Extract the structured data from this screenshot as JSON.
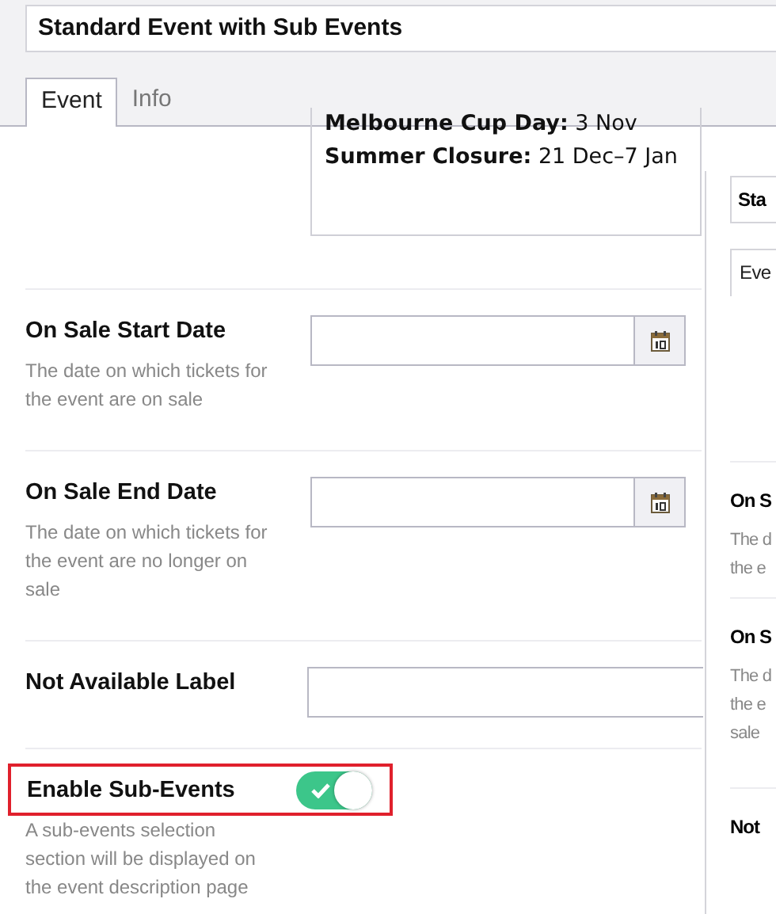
{
  "window": {
    "title": "Standard Event with Sub Events"
  },
  "tabs": [
    {
      "label": "Event",
      "selected": true
    },
    {
      "label": "Info",
      "selected": false
    }
  ],
  "notes": [
    "**Melbourne Cup Day:** 3 Nov",
    "**Summer Closure:** 21 Dec–7 Jan"
  ],
  "fields": [
    {
      "kind": "date",
      "label": "On Sale Start Date",
      "description": "The date on which tickets for the event are on sale"
    },
    {
      "kind": "date",
      "label": "On Sale End Date",
      "description": "The date on which tickets for the event are no longer on sale"
    },
    {
      "kind": "text",
      "label": "Not Available Label"
    },
    {
      "kind": "toggle",
      "label": "Enable Sub-Events",
      "on": true,
      "highlighted": true,
      "description": "A sub-events selection section will be displayed on the event description page"
    }
  ],
  "overlay_window": {
    "title": "Sta",
    "tabs": [
      {
        "label": "Eve",
        "selected": true
      }
    ],
    "fields": [
      {
        "label": "On S",
        "lines": [
          "The d",
          "the e"
        ]
      },
      {
        "label": "On S",
        "lines": [
          "The d",
          "the e",
          "sale"
        ]
      },
      {
        "label": "Not"
      }
    ]
  }
}
